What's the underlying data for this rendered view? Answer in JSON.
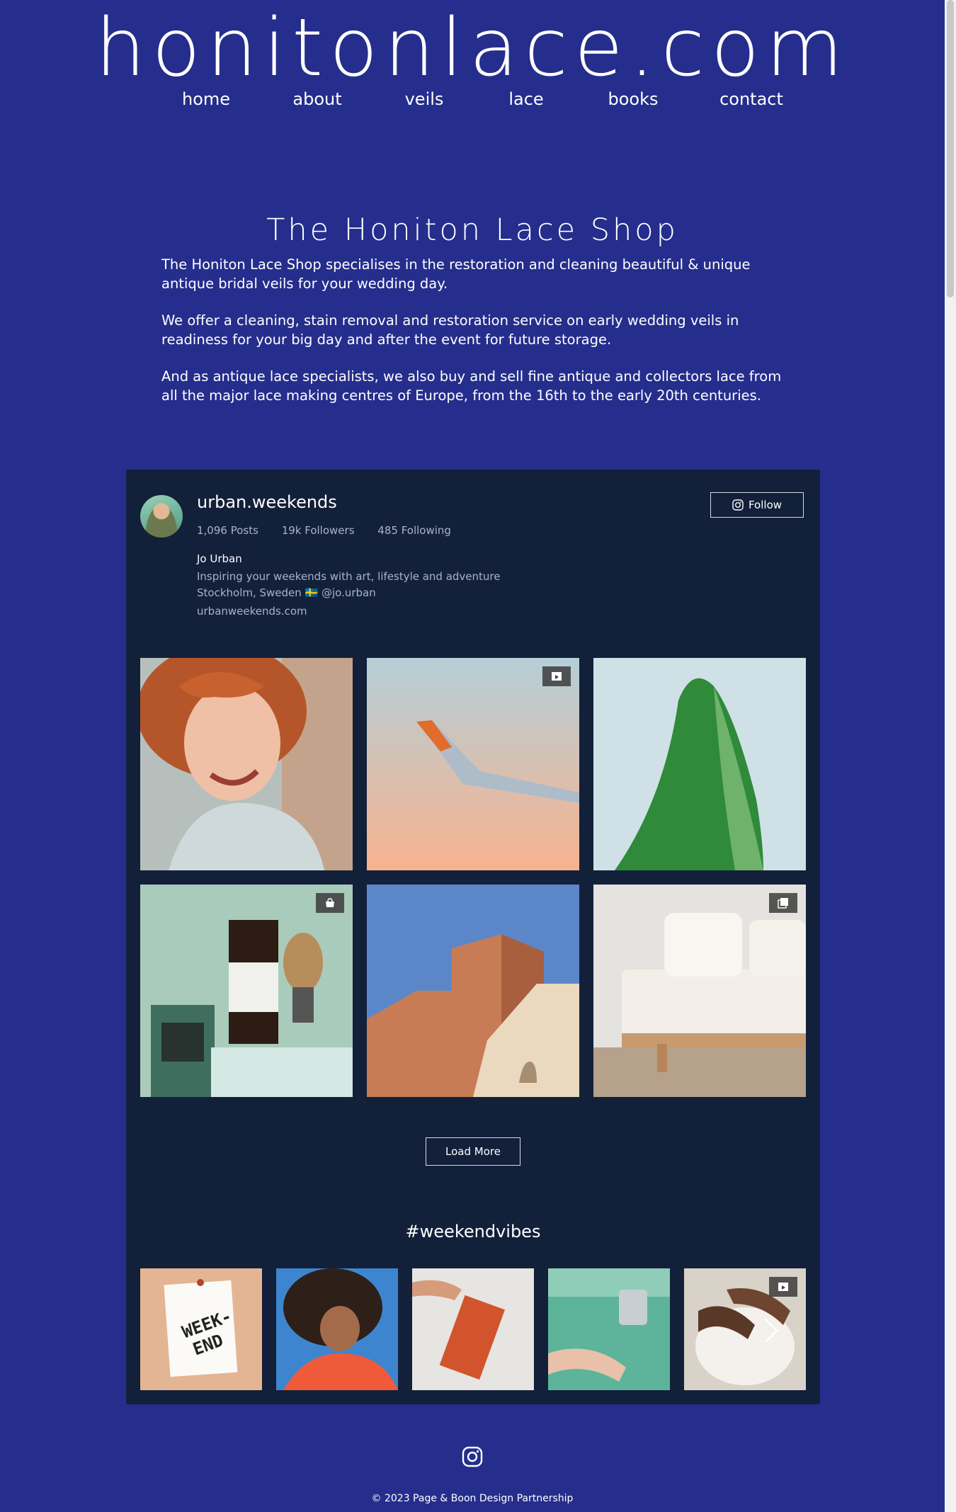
{
  "header": {
    "site_title": "honitonlace.com",
    "nav": [
      "home",
      "about",
      "veils",
      "lace",
      "books",
      "contact"
    ]
  },
  "intro": {
    "title": "The Honiton Lace Shop",
    "paragraphs": [
      "The Honiton Lace Shop specialises in the restoration and cleaning beautiful & unique antique bridal veils for your wedding day.",
      "We offer a cleaning, stain removal and restoration service on early wedding veils in readiness for your big day and after the event for future storage.",
      "And as antique lace specialists, we also buy and sell fine antique and collectors lace from all the major lace making centres of Europe, from the 16th to the early 20th centuries."
    ]
  },
  "instagram": {
    "username": "urban.weekends",
    "posts": "1,096 Posts",
    "followers": "19k Followers",
    "following": "485 Following",
    "follow_label": "Follow",
    "bio_name": "Jo Urban",
    "bio_lines": [
      "Inspiring your weekends with art, lifestyle and adventure",
      "Stockholm, Sweden 🇸🇪 @jo.urban"
    ],
    "website": "urbanweekends.com",
    "grid": [
      {
        "name": "laughing-woman-photo",
        "badge": null
      },
      {
        "name": "airplane-wing-photo",
        "badge": "reel"
      },
      {
        "name": "green-leaf-photo",
        "badge": null
      },
      {
        "name": "toiletries-photo",
        "badge": "shop"
      },
      {
        "name": "terracotta-building-photo",
        "badge": null
      },
      {
        "name": "white-sofa-photo",
        "badge": "carousel"
      }
    ],
    "load_more_label": "Load More",
    "hashtag": "#weekendvibes",
    "strip": [
      {
        "name": "weekend-note-photo",
        "badge": null,
        "note_text": "WEEK-\nEND"
      },
      {
        "name": "curly-hair-woman-photo",
        "badge": null
      },
      {
        "name": "orange-notebook-photo",
        "badge": null
      },
      {
        "name": "hands-washing-photo",
        "badge": null
      },
      {
        "name": "pottery-hands-photo",
        "badge": "reel"
      }
    ]
  },
  "footer": {
    "icon": "instagram-icon",
    "copyright": "© 2023 Page & Boon Design Partnership"
  },
  "colors": {
    "background": "#252e8c",
    "feed_background": "#12203a",
    "text": "#ffffff",
    "muted_text": "#a8b3c6"
  }
}
